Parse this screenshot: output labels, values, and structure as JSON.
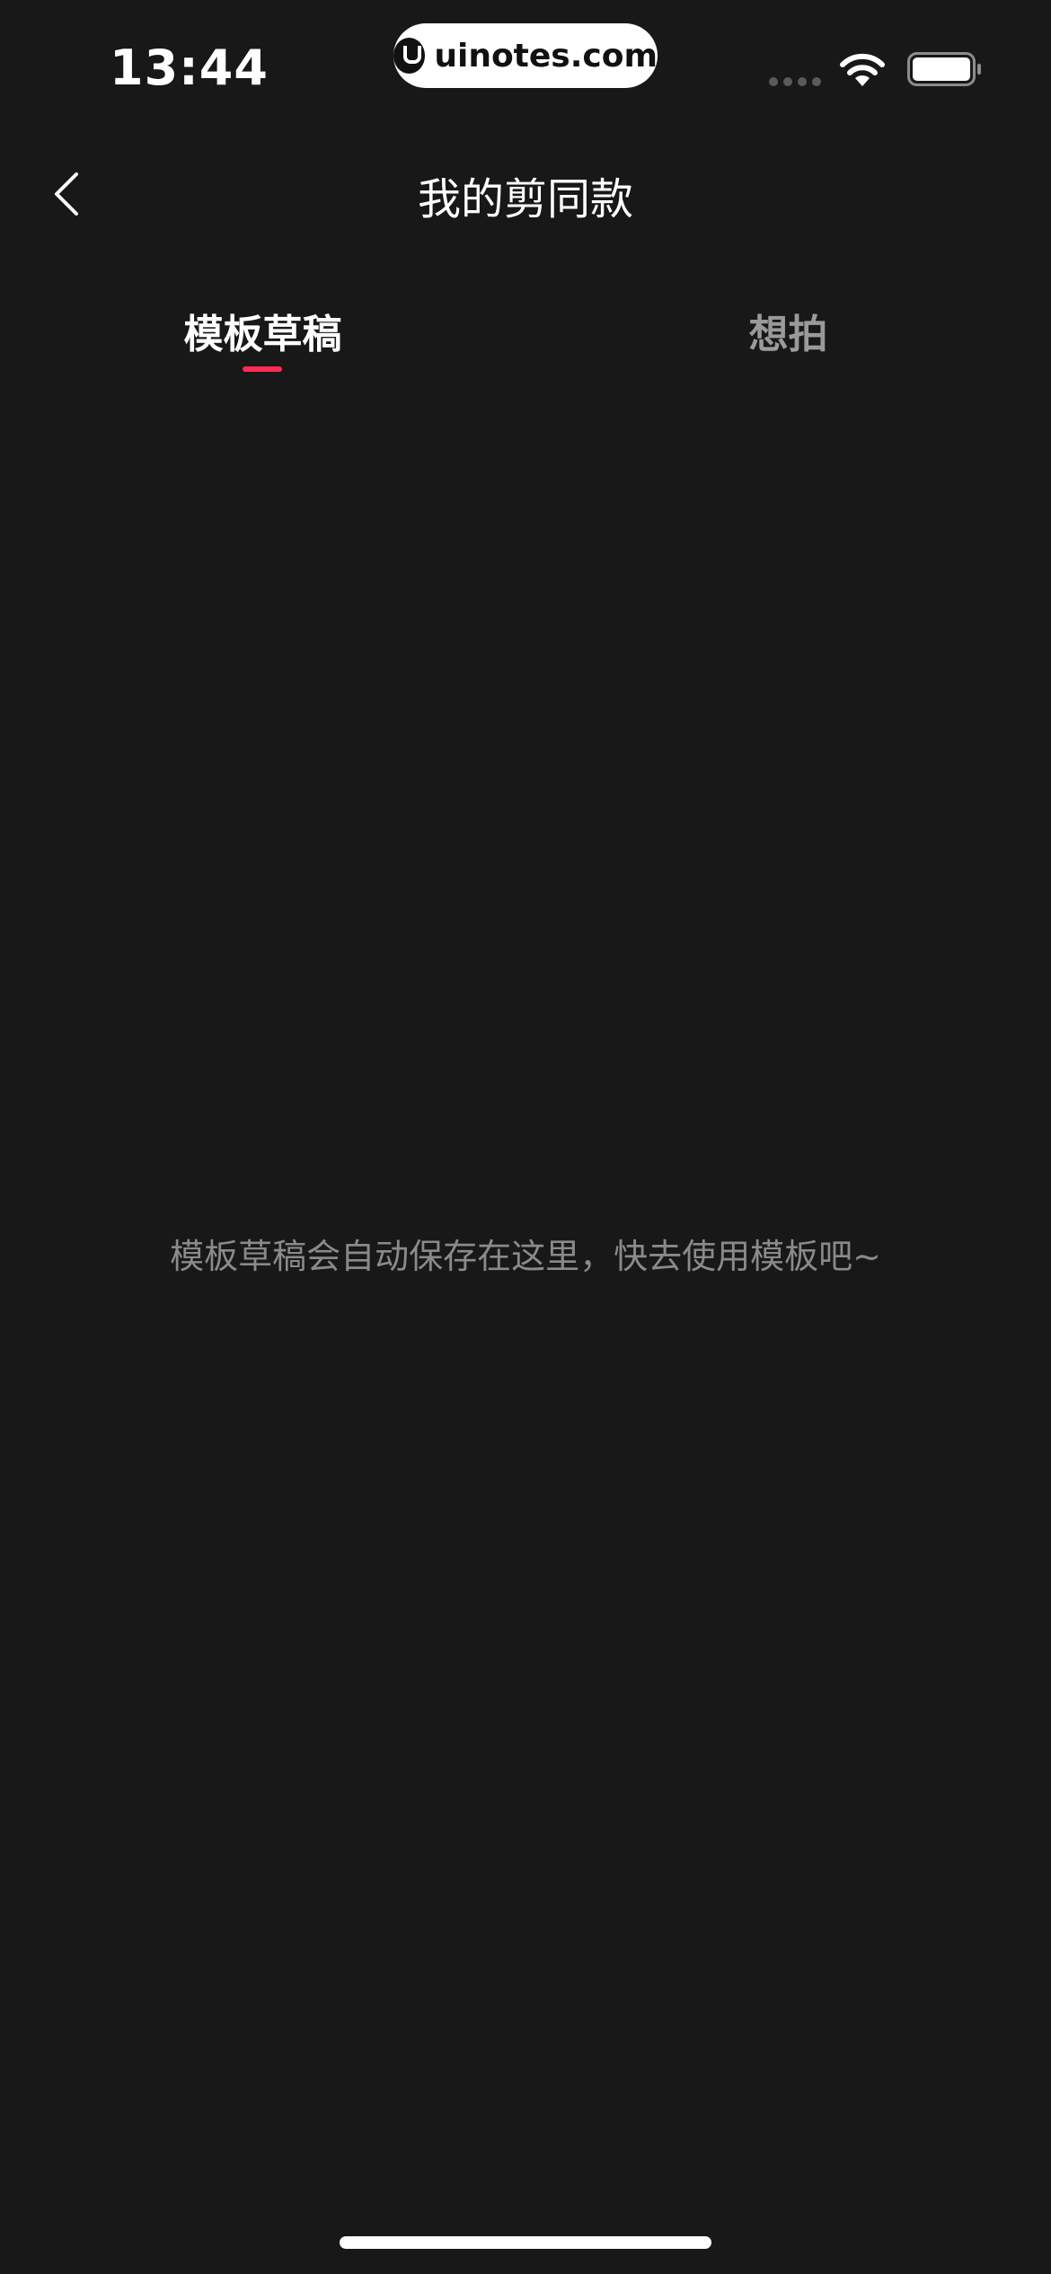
{
  "status_bar": {
    "time": "13:44",
    "watermark": "uinotes.com",
    "icons": [
      "signal-dots-icon",
      "wifi-icon",
      "battery-icon"
    ]
  },
  "nav": {
    "back_icon": "chevron-left-icon",
    "title": "我的剪同款"
  },
  "tabs": [
    {
      "label": "模板草稿",
      "active": true
    },
    {
      "label": "想拍",
      "active": false
    }
  ],
  "empty_state": {
    "message": "模板草稿会自动保存在这里，快去使用模板吧~"
  },
  "colors": {
    "background": "#181818",
    "accent": "#fe2c55",
    "inactive_tab": "#9a9a9a",
    "empty_text": "#8a8a8a"
  }
}
